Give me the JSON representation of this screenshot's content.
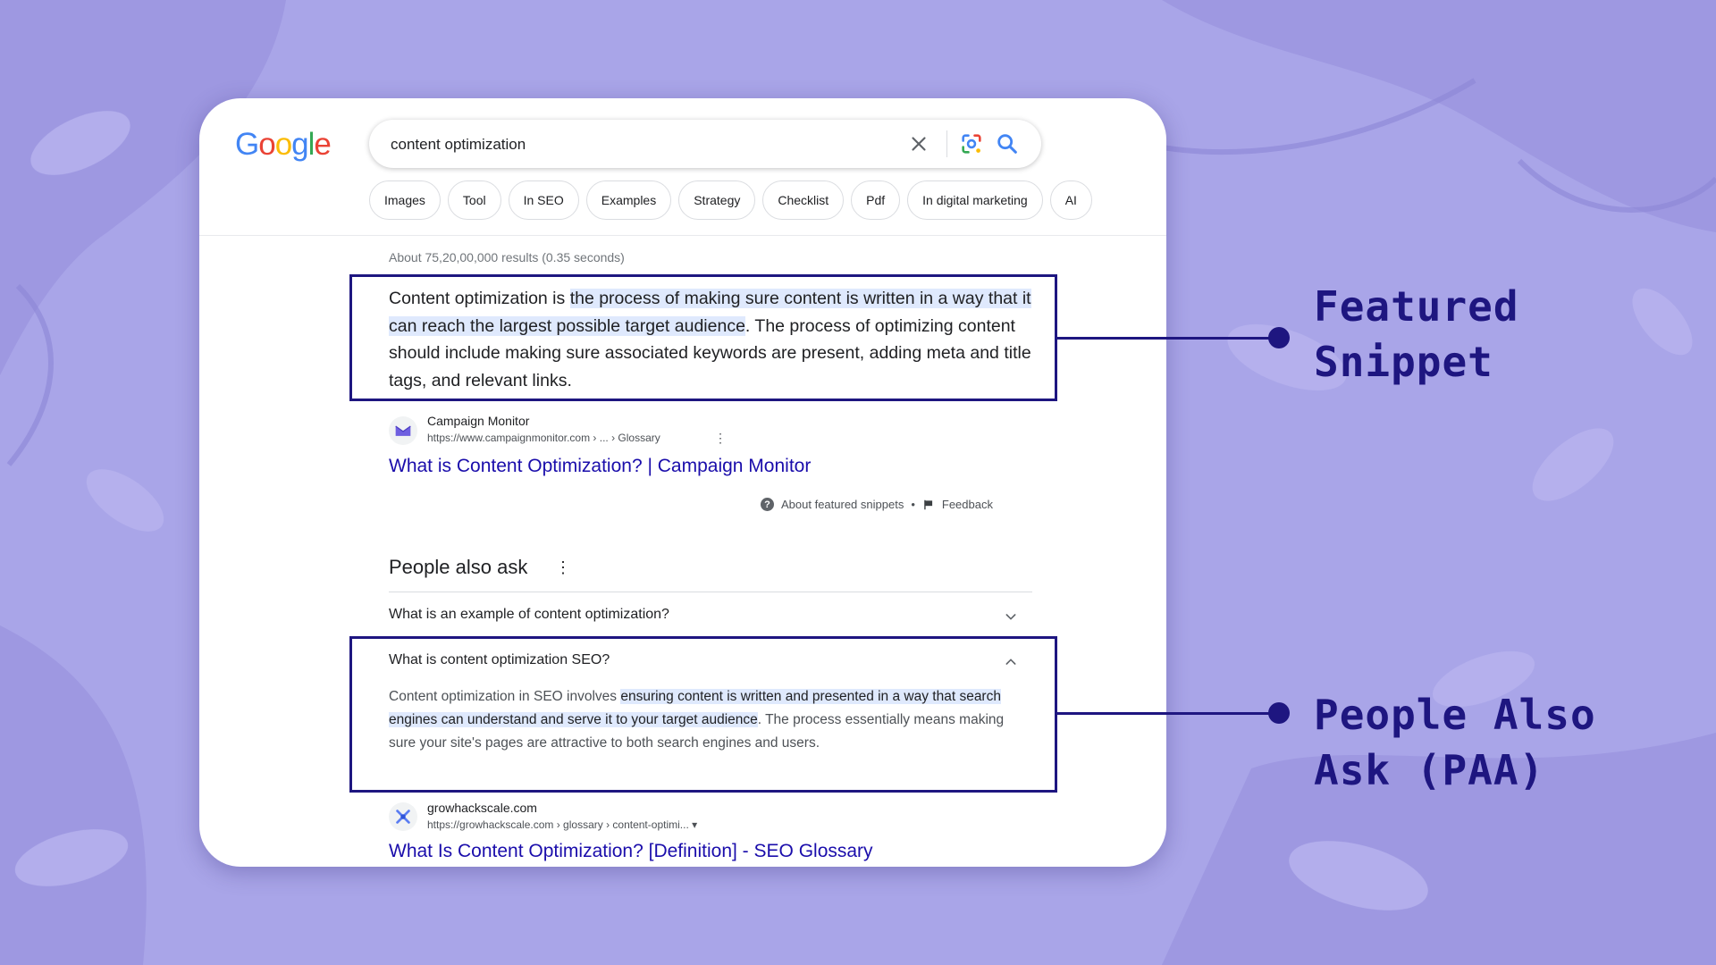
{
  "colors": {
    "background": "#a9a5e8",
    "annotation": "#1e1680",
    "link": "#1a0dab",
    "highlight": "#dfe9fd"
  },
  "google": {
    "logo_text": "Google",
    "search": {
      "query": "content optimization",
      "icons": [
        "clear-icon",
        "google-lens-icon",
        "search-icon"
      ]
    },
    "chips": [
      "Images",
      "Tool",
      "In SEO",
      "Examples",
      "Strategy",
      "Checklist",
      "Pdf",
      "In digital marketing",
      "AI"
    ],
    "result_stats": "About 75,20,00,000 results (0.35 seconds)",
    "featured_snippet": {
      "text_before": "Content optimization is ",
      "text_highlight": "the process of making sure content is written in a way that it can reach the largest possible target audience",
      "text_after": ". The process of optimizing content should include making sure associated keywords are present, adding meta and title tags, and relevant links.",
      "source": {
        "site_name": "Campaign Monitor",
        "url": "https://www.campaignmonitor.com › ... › Glossary",
        "title": "What is Content Optimization? | Campaign Monitor"
      },
      "footer": {
        "about": "About featured snippets",
        "separator": "•",
        "feedback": "Feedback"
      }
    },
    "people_also_ask": {
      "heading": "People also ask",
      "questions": [
        {
          "question": "What is an example of content optimization?",
          "expanded": false
        },
        {
          "question": "What is content optimization SEO?",
          "expanded": true
        }
      ],
      "answer": {
        "text_before": "Content optimization in SEO involves ",
        "text_highlight": "ensuring content is written and presented in a way that search engines can understand and serve it to your target audience",
        "text_after": ". The process essentially means making sure your site's pages are attractive to both search engines and users."
      },
      "source": {
        "site_name": "growhackscale.com",
        "url": "https://growhackscale.com › glossary › content-optimi... ▾",
        "title": "What Is Content Optimization? [Definition] - SEO Glossary"
      }
    }
  },
  "annotations": {
    "featured_snippet_line1": "Featured",
    "featured_snippet_line2": "Snippet",
    "paa_line1": "People Also",
    "paa_line2": "Ask (PAA)"
  }
}
